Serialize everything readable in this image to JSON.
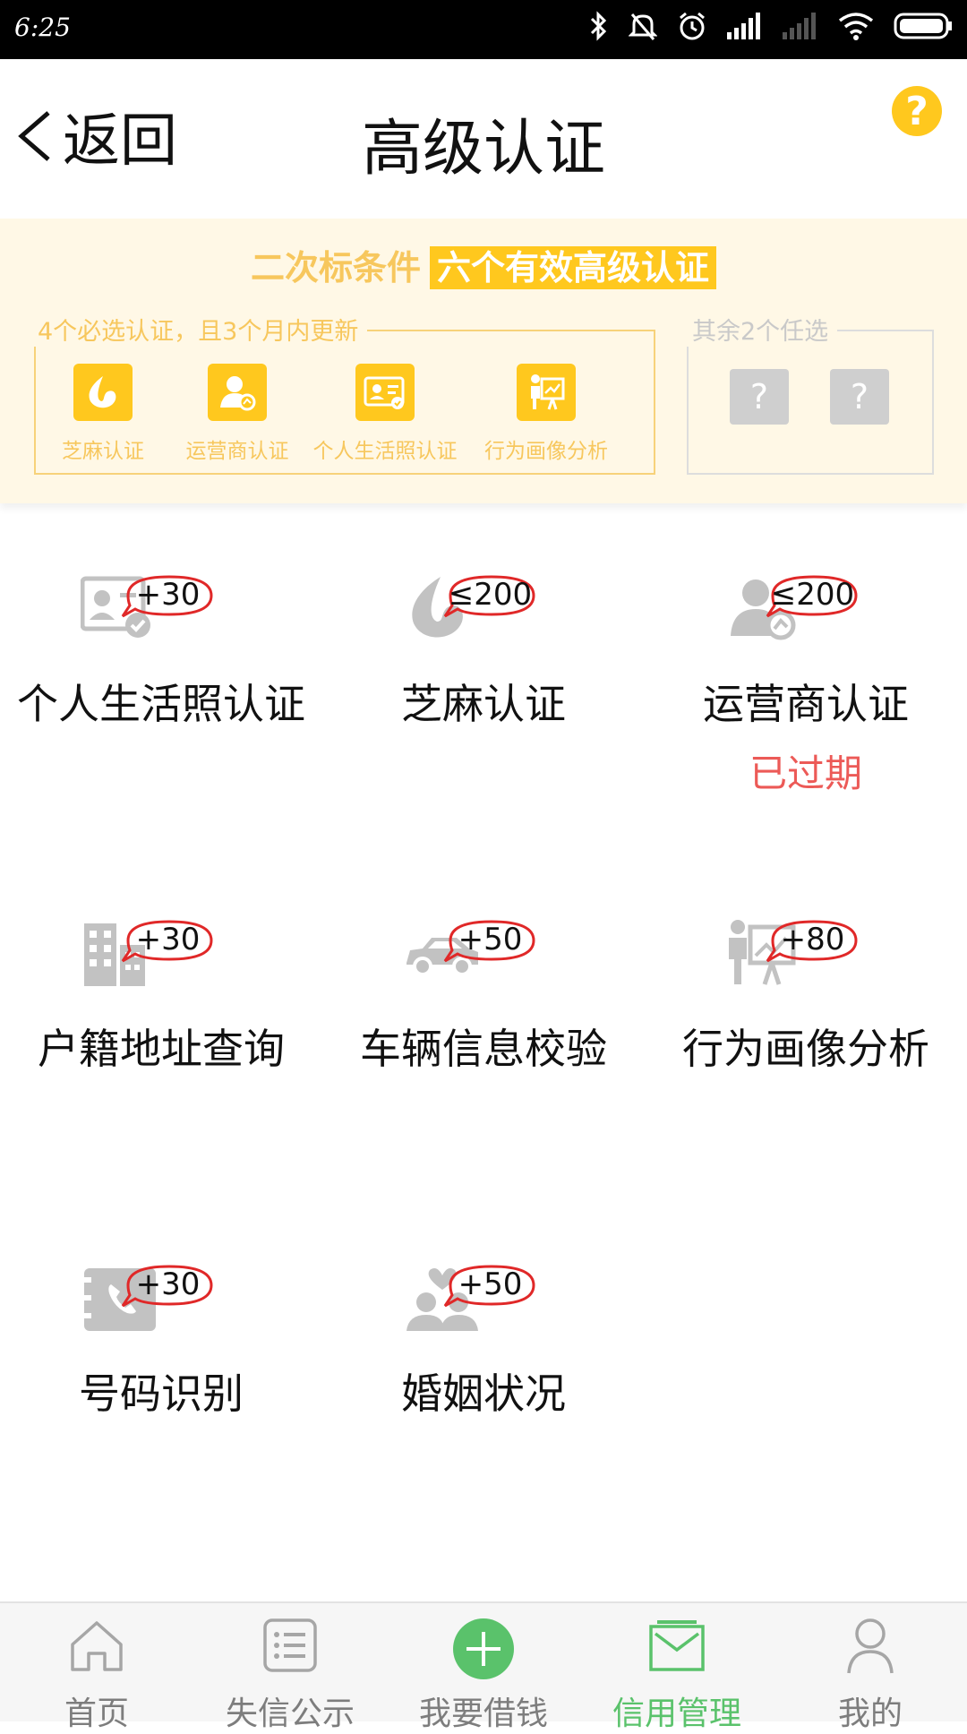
{
  "status_bar": {
    "time": "6:25"
  },
  "header": {
    "back_label": "返回",
    "title": "高级认证",
    "help_symbol": "?"
  },
  "banner": {
    "heading": "二次标条件",
    "heading_highlight": "六个有效高级认证",
    "required_title": "4个必选认证，且3个月内更新",
    "required_items": [
      {
        "label": "芝麻认证",
        "icon": "sesame-icon"
      },
      {
        "label": "运营商认证",
        "icon": "operator-icon"
      },
      {
        "label": "个人生活照认证",
        "icon": "id-photo-icon"
      },
      {
        "label": "行为画像分析",
        "icon": "behavior-icon"
      }
    ],
    "optional_title": "其余2个任选",
    "optional_items": [
      "?",
      "?"
    ]
  },
  "grid": [
    {
      "label": "个人生活照认证",
      "score": "+30",
      "icon": "id-photo-icon",
      "status": ""
    },
    {
      "label": "芝麻认证",
      "score": "≤200",
      "icon": "sesame-icon",
      "status": ""
    },
    {
      "label": "运营商认证",
      "score": "≤200",
      "icon": "operator-icon",
      "status": "已过期"
    },
    {
      "label": "户籍地址查询",
      "score": "+30",
      "icon": "building-icon",
      "status": ""
    },
    {
      "label": "车辆信息校验",
      "score": "+50",
      "icon": "car-icon",
      "status": ""
    },
    {
      "label": "行为画像分析",
      "score": "+80",
      "icon": "behavior-icon",
      "status": ""
    },
    {
      "label": "号码识别",
      "score": "+30",
      "icon": "phone-book-icon",
      "status": ""
    },
    {
      "label": "婚姻状况",
      "score": "+50",
      "icon": "couple-icon",
      "status": ""
    }
  ],
  "bottom_nav": [
    {
      "label": "首页",
      "icon": "home-icon",
      "active": false
    },
    {
      "label": "失信公示",
      "icon": "list-icon",
      "active": false
    },
    {
      "label": "我要借钱",
      "icon": "plus-circle-icon",
      "active": false
    },
    {
      "label": "信用管理",
      "icon": "inbox-icon",
      "active": true
    },
    {
      "label": "我的",
      "icon": "user-icon",
      "active": false
    }
  ],
  "colors": {
    "accent_yellow": "#ffc81e",
    "active_green": "#5ac26b",
    "expired_red": "#ec5a57",
    "icon_gray": "#c2c2c2"
  }
}
